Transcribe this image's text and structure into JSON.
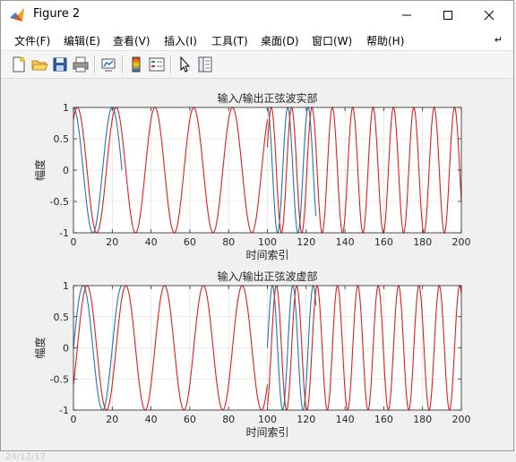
{
  "window": {
    "title": "Figure 2"
  },
  "menubar": {
    "items": [
      "文件(F)",
      "编辑(E)",
      "查看(V)",
      "插入(I)",
      "工具(T)",
      "桌面(D)",
      "窗口(W)",
      "帮助(H)"
    ],
    "overflow_icon": "curved-arrow-icon"
  },
  "toolbar": {
    "icons": [
      "new-figure-icon",
      "open-folder-icon",
      "save-icon",
      "print-icon",
      "link-plot-icon",
      "colorbar-icon",
      "legend-icon",
      "pointer-icon",
      "property-inspector-icon"
    ]
  },
  "colors": {
    "series_blue": "#1f77b4",
    "series_red": "#e0201b",
    "axes_bg": "#ffffff",
    "figure_bg": "#f0f0f0"
  },
  "background_fragments": [
    "24/12/17"
  ],
  "chart_data": [
    {
      "type": "line",
      "title": "输入/输出正弦波实部",
      "xlabel": "时间索引",
      "ylabel": "幅度",
      "xlim": [
        0,
        200
      ],
      "ylim": [
        -1,
        1
      ],
      "xticks": [
        "0",
        "20",
        "40",
        "60",
        "80",
        "100",
        "120",
        "140",
        "160",
        "180",
        "200"
      ],
      "yticks": [
        "1",
        "0.5",
        "0",
        "-0.5",
        "-1"
      ],
      "grid": true,
      "series": [
        {
          "color": "#1f77b4",
          "function": "cos",
          "segments": [
            {
              "x0": 0,
              "x1": 25,
              "period": 20,
              "shift": 0
            },
            {
              "x0": 100,
              "x1": 125,
              "period": 10.5,
              "shift": 0
            }
          ]
        },
        {
          "color": "#e0201b",
          "function": "cos",
          "segments": [
            {
              "x0": 0,
              "x1": 100,
              "period": 20,
              "shift": 2
            },
            {
              "x0": 100,
              "x1": 200,
              "period": 10.5,
              "shift": 2
            }
          ]
        }
      ]
    },
    {
      "type": "line",
      "title": "输入/输出正弦波虚部",
      "xlabel": "时间索引",
      "ylabel": "幅度",
      "xlim": [
        0,
        200
      ],
      "ylim": [
        -1,
        1
      ],
      "xticks": [
        "0",
        "20",
        "40",
        "60",
        "80",
        "100",
        "120",
        "140",
        "160",
        "180",
        "200"
      ],
      "yticks": [
        "1",
        "0.5",
        "0",
        "-0.5",
        "-1"
      ],
      "grid": true,
      "series": [
        {
          "color": "#1f77b4",
          "function": "sin",
          "segments": [
            {
              "x0": 0,
              "x1": 25,
              "period": 20,
              "shift": 0
            },
            {
              "x0": 100,
              "x1": 125,
              "period": 10.5,
              "shift": 0
            }
          ]
        },
        {
          "color": "#e0201b",
          "function": "sin",
          "segments": [
            {
              "x0": 0,
              "x1": 100,
              "period": 20,
              "shift": 2
            },
            {
              "x0": 100,
              "x1": 200,
              "period": 10.5,
              "shift": 2
            }
          ]
        }
      ]
    }
  ]
}
